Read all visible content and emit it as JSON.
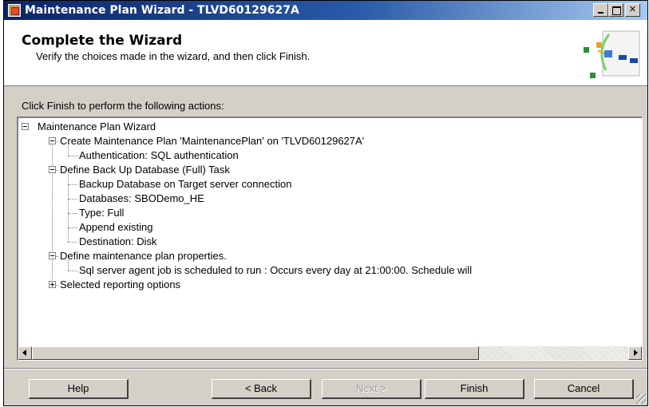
{
  "window": {
    "title": "Maintenance Plan Wizard - TLVD60129627A"
  },
  "header": {
    "title": "Complete the Wizard",
    "subtitle": "Verify the choices made in the wizard, and then click Finish."
  },
  "actions_label": "Click Finish to perform the following actions:",
  "tree": {
    "root": "Maintenance Plan Wizard",
    "create_plan": "Create Maintenance Plan 'MaintenancePlan' on 'TLVD60129627A'",
    "authentication": "Authentication: SQL authentication",
    "backup_task": "Define Back Up Database (Full) Task",
    "backup_target": "Backup Database on Target server connection",
    "databases": "Databases: SBODemo_HE",
    "type": "Type: Full",
    "append": "Append existing",
    "destination": "Destination: Disk",
    "plan_properties": "Define maintenance plan properties.",
    "schedule": "Sql server agent job is scheduled to run : Occurs every day at 21:00:00. Schedule will",
    "reporting": "Selected reporting options"
  },
  "buttons": {
    "help": "Help",
    "back": "< Back",
    "next": "Next >",
    "finish": "Finish",
    "cancel": "Cancel"
  },
  "icons": {
    "app": "wizard-app-icon",
    "minimize": "minimize-icon",
    "maximize": "maximize-icon",
    "close": "close-icon"
  }
}
